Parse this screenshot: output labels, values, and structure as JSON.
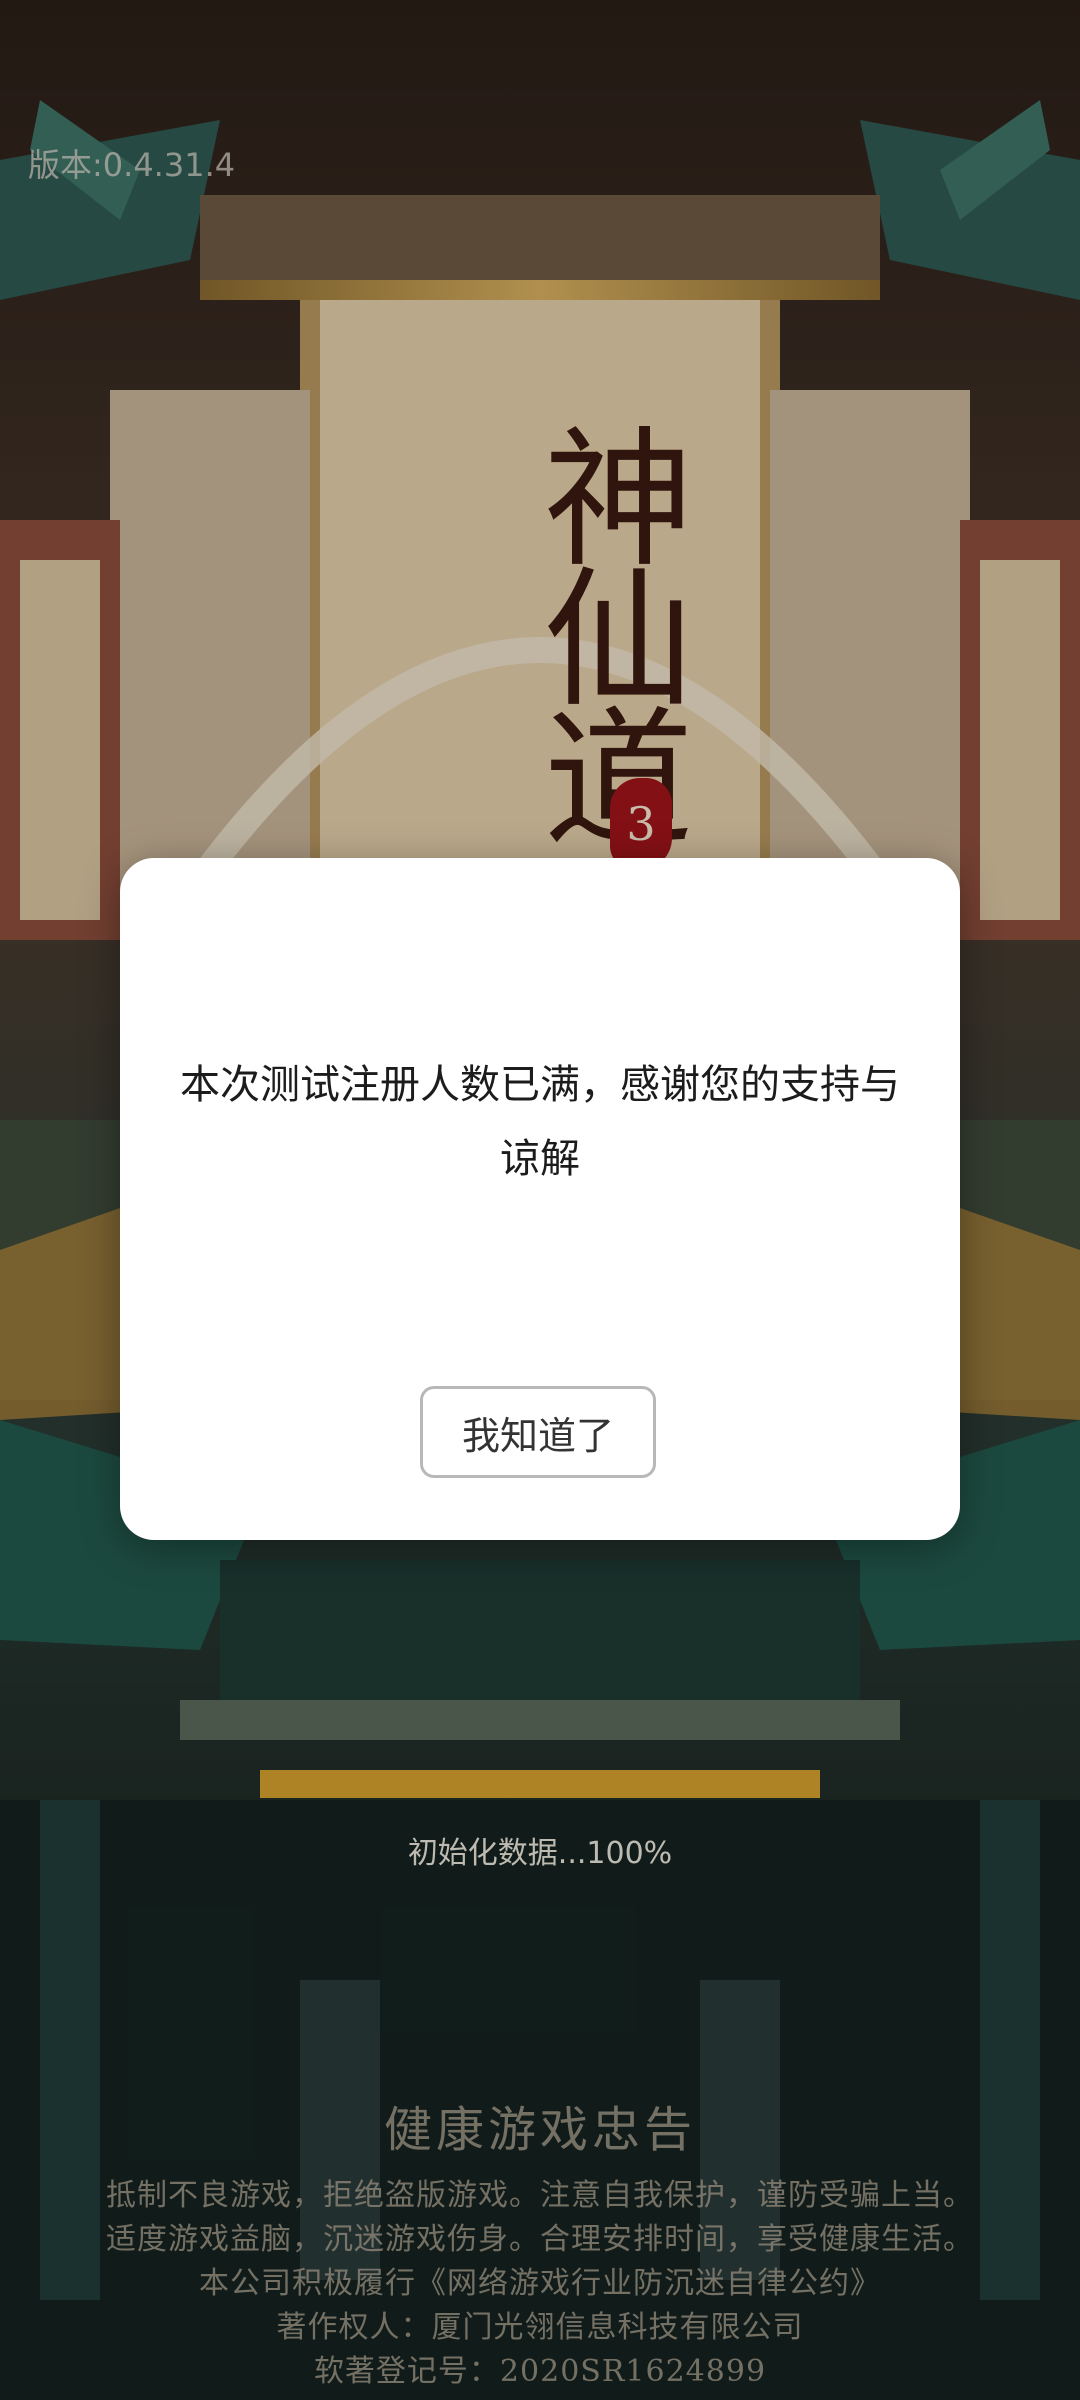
{
  "version_label": "版本:0.4.31.4",
  "logo": {
    "title": "神仙道",
    "edition": "3"
  },
  "dialog": {
    "message": "本次测试注册人数已满，感谢您的支持与谅解",
    "confirm_label": "我知道了"
  },
  "loading": {
    "text": "初始化数据...100%",
    "progress": 1.0
  },
  "health_notice": {
    "title": "健康游戏忠告",
    "lines": [
      "抵制不良游戏，拒绝盗版游戏。注意自我保护，谨防受骗上当。",
      "适度游戏益脑，沉迷游戏伤身。合理安排时间，享受健康生活。",
      "本公司积极履行《网络游戏行业防沉迷自律公约》",
      "著作权人：厦门光翎信息科技有限公司",
      "软著登记号：2020SR1624899"
    ]
  },
  "colors": {
    "dialog_bg": "#ffffff",
    "seal": "#a0141a",
    "teal_accent": "#2f6a5e",
    "gold_accent": "#c89a3a"
  }
}
